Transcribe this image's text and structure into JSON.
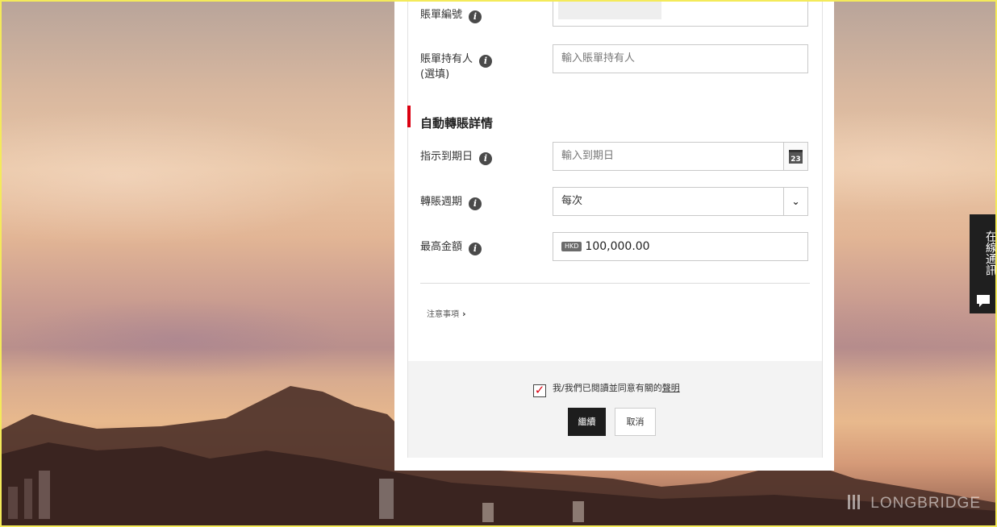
{
  "form": {
    "bill_number": {
      "label": "賬單編號"
    },
    "bill_holder": {
      "label": "賬單持有人",
      "optional_note": "(選填)",
      "placeholder": "輸入賬單持有人"
    },
    "section_title": "自動轉賬詳情",
    "due_date": {
      "label": "指示到期日",
      "placeholder": "輸入到期日",
      "calendar_day": "23"
    },
    "frequency": {
      "label": "轉賬週期",
      "value": "每次"
    },
    "max_amount": {
      "label": "最高金額",
      "currency": "HKD",
      "value": "100,000.00"
    },
    "notice_label": "注意事項",
    "info_icon_glyph": "i"
  },
  "footer": {
    "agree_text": "我/我們已閱讀並同意有關的",
    "agree_link": "聲明",
    "agree_checked": true,
    "continue_label": "繼續",
    "cancel_label": "取消"
  },
  "chat": {
    "label": "在線通訊"
  },
  "watermark": "LONGBRIDGE",
  "colors": {
    "accent_red": "#db0011",
    "primary_button": "#1d1d1d"
  }
}
